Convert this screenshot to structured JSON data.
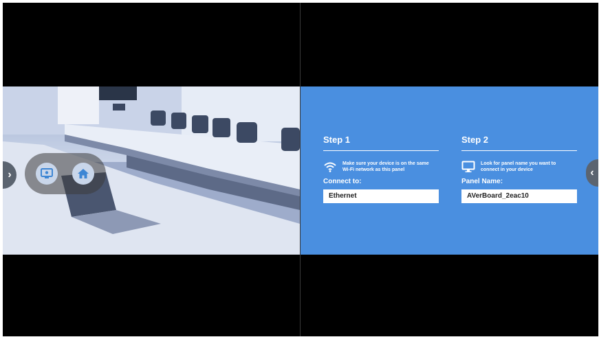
{
  "colors": {
    "panel_blue": "#4a8fe0",
    "background": "#000000"
  },
  "left_panel": {
    "image": "conference-room-photo",
    "toolbar": {
      "buttons": [
        "screen-share-icon",
        "home-icon"
      ]
    },
    "nav_left": "‹",
    "nav_left_symbol": "›"
  },
  "right_panel": {
    "nav_right_symbol": "‹",
    "steps": [
      {
        "title": "Step 1",
        "icon": "wifi-icon",
        "description_line1": "Make sure your device is on the same",
        "description_line2": "Wi-Fi network as this panel",
        "field_label": "Connect to:",
        "field_value": "Ethernet"
      },
      {
        "title": "Step 2",
        "icon": "monitor-icon",
        "description_line1": "Look for panel name you want to",
        "description_line2": "connect in your device",
        "field_label": "Panel Name:",
        "field_value": "AVerBoard_2eac10"
      }
    ]
  }
}
